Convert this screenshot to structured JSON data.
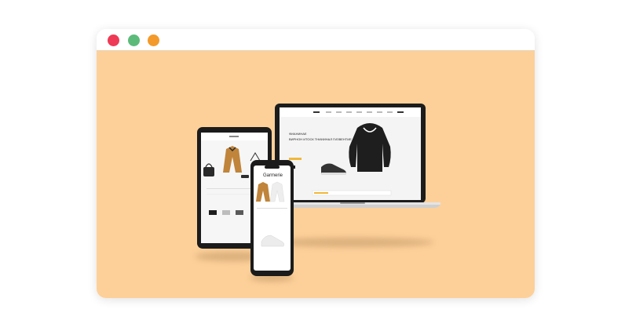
{
  "window": {
    "controls": [
      {
        "name": "close",
        "color": "#ee3a55"
      },
      {
        "name": "minimize",
        "color": "#5dbb7a"
      },
      {
        "name": "maximize",
        "color": "#f39a2b"
      }
    ]
  },
  "colors": {
    "canvas": "#fdd09a",
    "accent": "#f2b73a",
    "device_frame": "#1b1b1b"
  },
  "laptop": {
    "headline_small": "ФИАНИНАЕ",
    "headline": "ВИРНОН ИТОСК ТНИИИНАЛ ГИЗВЕНТИЕ"
  },
  "phone": {
    "title": "Garmerie"
  }
}
